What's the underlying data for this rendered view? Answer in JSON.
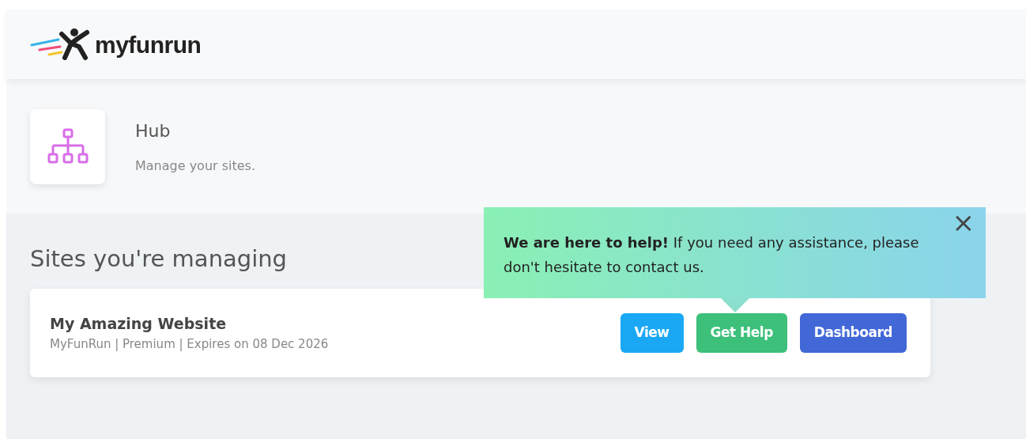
{
  "header": {
    "logo_text": "myfunrun"
  },
  "hub": {
    "title": "Hub",
    "subtitle": "Manage your sites."
  },
  "section_title": "Sites you're managing",
  "sites": [
    {
      "name": "My Amazing Website",
      "details": "MyFunRun | Premium | Expires on 08 Dec 2026",
      "buttons": [
        {
          "label": "View"
        },
        {
          "label": "Get Help"
        },
        {
          "label": "Dashboard"
        }
      ]
    }
  ],
  "help_popover": {
    "text": "**We are here to help!** If you need any assistance, please don't hesitate to contact us.",
    "close": "×"
  }
}
